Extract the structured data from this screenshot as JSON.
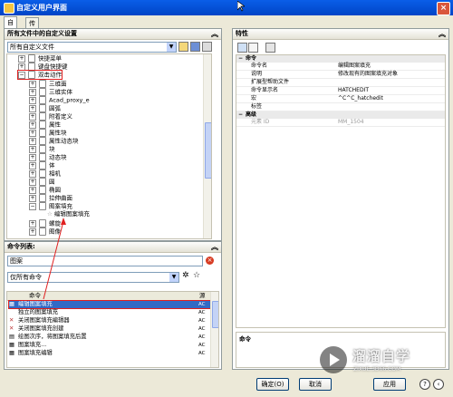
{
  "window": {
    "title": "自定义用户界面"
  },
  "tabs": [
    {
      "label": "自定义"
    },
    {
      "label": "传输"
    }
  ],
  "left_top": {
    "header": "所有文件中的自定义设置",
    "combo_value": "所有自定义文件",
    "tree": [
      {
        "label": "快捷菜单",
        "level": 1,
        "exp": "+"
      },
      {
        "label": "键盘快捷键",
        "level": 1,
        "exp": "+"
      },
      {
        "label": "双击动作",
        "level": 1,
        "exp": "−"
      },
      {
        "label": "三维面",
        "level": 2,
        "exp": "+"
      },
      {
        "label": "三维实体",
        "level": 2,
        "exp": "+"
      },
      {
        "label": "Acad_proxy_e",
        "level": 2,
        "exp": "+"
      },
      {
        "label": "圆弧",
        "level": 2,
        "exp": "+"
      },
      {
        "label": "附着定义",
        "level": 2,
        "exp": "+"
      },
      {
        "label": "属性",
        "level": 2,
        "exp": "+"
      },
      {
        "label": "属性块",
        "level": 2,
        "exp": "+"
      },
      {
        "label": "属性动态块",
        "level": 2,
        "exp": "+"
      },
      {
        "label": "块",
        "level": 2,
        "exp": "+"
      },
      {
        "label": "动态块",
        "level": 2,
        "exp": "+"
      },
      {
        "label": "体",
        "level": 2,
        "exp": "+"
      },
      {
        "label": "相机",
        "level": 2,
        "exp": "+"
      },
      {
        "label": "圆",
        "level": 2,
        "exp": "+"
      },
      {
        "label": "椭圆",
        "level": 2,
        "exp": "+"
      },
      {
        "label": "拉伸曲面",
        "level": 2,
        "exp": "+"
      },
      {
        "label": "图案填充",
        "level": 2,
        "exp": "−"
      },
      {
        "label": "编辑图案填充",
        "level": 3,
        "exp": ""
      },
      {
        "label": "螺旋",
        "level": 2,
        "exp": "+"
      },
      {
        "label": "图像",
        "level": 2,
        "exp": "+"
      }
    ]
  },
  "command_list": {
    "header": "命令列表:",
    "search_value": "图案",
    "filter_value": "仅所有命令",
    "col_command": "命令",
    "col_source": "源",
    "rows": [
      {
        "label": "编辑图案填充",
        "src": "AC"
      },
      {
        "label": "独立的图案填充",
        "src": "AC"
      },
      {
        "label": "关闭图案填充编辑器",
        "src": "AC"
      },
      {
        "label": "关闭图案填充创建",
        "src": "AC"
      },
      {
        "label": "绘图次序，将图案填充后置",
        "src": "AC"
      },
      {
        "label": "图案填充...",
        "src": "AC"
      },
      {
        "label": "图案填充编辑",
        "src": "AC"
      }
    ]
  },
  "properties": {
    "header": "特性",
    "cat_command": "命令",
    "rows": [
      {
        "k": "命令名",
        "v": "编辑图案填充"
      },
      {
        "k": "说明",
        "v": "修改现有的图案填充对象"
      },
      {
        "k": "扩展型帮助文件",
        "v": ""
      },
      {
        "k": "命令显示名",
        "v": "HATCHEDIT"
      },
      {
        "k": "宏",
        "v": "^C^C_hatchedit"
      },
      {
        "k": "标签",
        "v": ""
      }
    ],
    "cat_advanced": "高级",
    "adv_rows": [
      {
        "k": "元素 ID",
        "v": "MM_1504"
      }
    ],
    "desc_title": "命令"
  },
  "buttons": {
    "ok": "确定(O)",
    "cancel": "取消",
    "apply": "应用"
  },
  "watermark": {
    "title": "溜溜自学",
    "sub": "ZIXUE.3D66.COM"
  }
}
